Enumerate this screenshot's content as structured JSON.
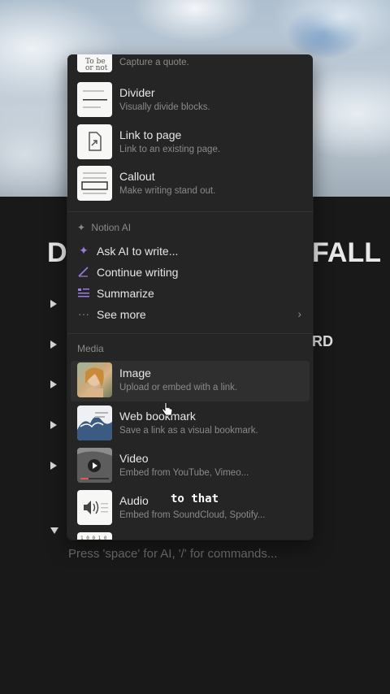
{
  "page": {
    "title_left": "D",
    "title_right": "FALL",
    "partial_text": "RD",
    "placeholder": "Press 'space' for AI, '/' for commands..."
  },
  "menu": {
    "blocks": [
      {
        "title": "",
        "desc": "Capture a quote.",
        "icon": "quote-thumb-icon"
      },
      {
        "title": "Divider",
        "desc": "Visually divide blocks.",
        "icon": "divider-thumb-icon"
      },
      {
        "title": "Link to page",
        "desc": "Link to an existing page.",
        "icon": "link-page-thumb-icon"
      },
      {
        "title": "Callout",
        "desc": "Make writing stand out.",
        "icon": "callout-thumb-icon"
      }
    ],
    "ai_section": "Notion AI",
    "ai_items": [
      {
        "label": "Ask AI to write...",
        "icon": "sparkle-icon"
      },
      {
        "label": "Continue writing",
        "icon": "pen-icon"
      },
      {
        "label": "Summarize",
        "icon": "summary-icon"
      },
      {
        "label": "See more",
        "icon": "more-dots-icon"
      }
    ],
    "media_section": "Media",
    "media_items": [
      {
        "title": "Image",
        "desc": "Upload or embed with a link.",
        "icon": "image-thumb-icon"
      },
      {
        "title": "Web bookmark",
        "desc": "Save a link as a visual bookmark.",
        "icon": "bookmark-thumb-icon"
      },
      {
        "title": "Video",
        "desc": "Embed from YouTube, Vimeo...",
        "icon": "video-thumb-icon"
      },
      {
        "title": "Audio",
        "desc": "Embed from SoundCloud, Spotify...",
        "icon": "audio-thumb-icon"
      }
    ]
  },
  "caption": "to that"
}
